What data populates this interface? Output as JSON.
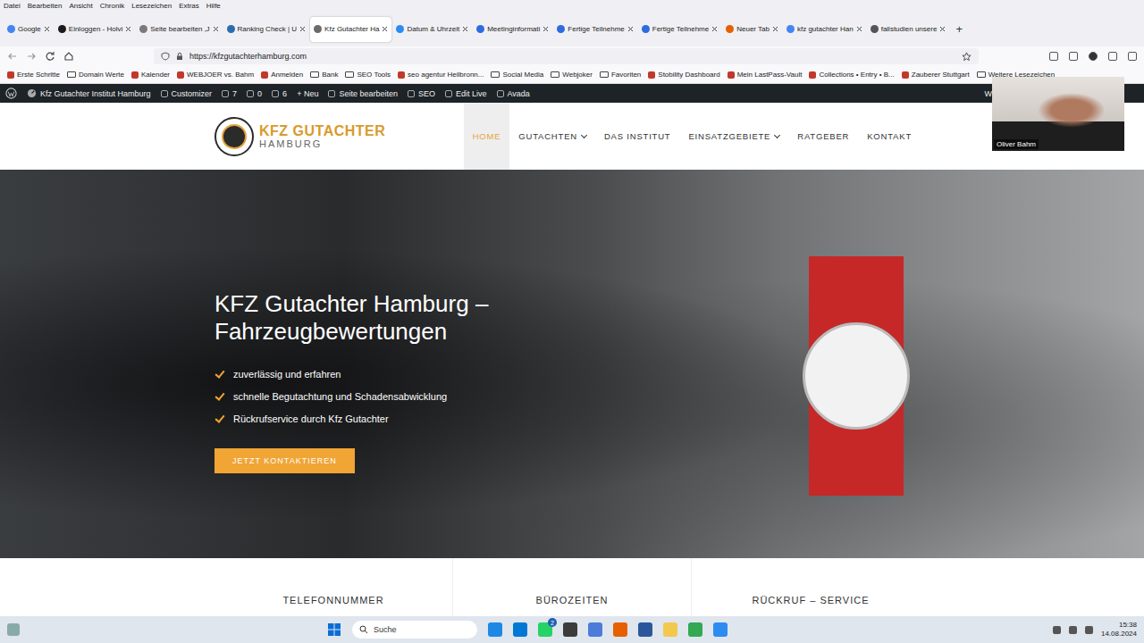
{
  "browser": {
    "menu": [
      "Datei",
      "Bearbeiten",
      "Ansicht",
      "Chronik",
      "Lesezeichen",
      "Extras",
      "Hilfe"
    ],
    "tabs": [
      {
        "label": "Google",
        "selected": false,
        "color": "#4285f4"
      },
      {
        "label": "Einloggen - Holvi",
        "selected": false,
        "color": "#1a1a1a"
      },
      {
        "label": "Seite bearbeiten ‚J",
        "selected": false,
        "color": "#7a7a7a"
      },
      {
        "label": "Ranking Check | U",
        "selected": false,
        "color": "#2b6cb0"
      },
      {
        "label": "Kfz Gutachter Ha",
        "selected": true,
        "color": "#6b6b6b"
      },
      {
        "label": "Datum & Uhrzeit",
        "selected": false,
        "color": "#2d8cf0"
      },
      {
        "label": "Meetinginformati",
        "selected": false,
        "color": "#2d6cdf"
      },
      {
        "label": "Fertige Teilnehme",
        "selected": false,
        "color": "#2d6cdf"
      },
      {
        "label": "Fertige Teilnehme",
        "selected": false,
        "color": "#2d6cdf"
      },
      {
        "label": "Neuer Tab",
        "selected": false,
        "color": "#e66000"
      },
      {
        "label": "kfz gutachter Han",
        "selected": false,
        "color": "#4285f4"
      },
      {
        "label": "fallstudien unsere",
        "selected": false,
        "color": "#555555"
      }
    ],
    "new_tab": "+",
    "url": "https://kfzgutachterhamburg.com",
    "bookmarks": [
      {
        "label": "Erste Schritte",
        "kind": "link"
      },
      {
        "label": "Domain Werte",
        "kind": "folder"
      },
      {
        "label": "Kalender",
        "kind": "link"
      },
      {
        "label": "WEBJOER vs. Bahm",
        "kind": "link"
      },
      {
        "label": "Anmelden",
        "kind": "link"
      },
      {
        "label": "Bank",
        "kind": "folder"
      },
      {
        "label": "SEO Tools",
        "kind": "folder"
      },
      {
        "label": "seo agentur Heilbronn...",
        "kind": "link"
      },
      {
        "label": "Social Media",
        "kind": "folder"
      },
      {
        "label": "Webjoker",
        "kind": "folder"
      },
      {
        "label": "Favoriten",
        "kind": "folder"
      },
      {
        "label": "Stobility Dashboard",
        "kind": "link"
      },
      {
        "label": "Mein LastPass-Vault",
        "kind": "link"
      },
      {
        "label": "Collections • Entry • B...",
        "kind": "link"
      },
      {
        "label": "Zauberer Stuttgart",
        "kind": "link"
      },
      {
        "label": "Weitere Lesezeichen",
        "kind": "folder"
      }
    ]
  },
  "admin_bar": {
    "site": "Kfz Gutachter Institut Hamburg",
    "items": [
      {
        "label": "Customizer",
        "kind": "icon"
      },
      {
        "label": "7",
        "kind": "icon"
      },
      {
        "label": "0",
        "kind": "icon"
      },
      {
        "label": "6",
        "kind": "icon"
      },
      {
        "label": "+ Neu",
        "kind": "plain"
      },
      {
        "label": "Seite bearbeiten",
        "kind": "icon"
      },
      {
        "label": "SEO",
        "kind": "icon"
      },
      {
        "label": "Edit Live",
        "kind": "icon"
      },
      {
        "label": "Avada",
        "kind": "icon"
      }
    ],
    "cut": "W"
  },
  "site": {
    "logo": {
      "title": "KFZ GUTACHTER",
      "subtitle": "HAMBURG"
    },
    "nav": [
      {
        "label": "HOME",
        "selected": true,
        "dropdown": false
      },
      {
        "label": "GUTACHTEN",
        "selected": false,
        "dropdown": true
      },
      {
        "label": "DAS INSTITUT",
        "selected": false,
        "dropdown": false
      },
      {
        "label": "EINSATZGEBIETE",
        "selected": false,
        "dropdown": true
      },
      {
        "label": "RATGEBER",
        "selected": false,
        "dropdown": false
      },
      {
        "label": "KONTAKT",
        "selected": false,
        "dropdown": false
      }
    ],
    "hero": {
      "title": "KFZ Gutachter Hamburg – Fahrzeugbewertungen",
      "points": [
        "zuverlässig und erfahren",
        "schnelle Begutachtung und Schadensabwicklung",
        "Rückrufservice durch Kfz Gutachter"
      ],
      "button": "JETZT KONTAKTIEREN"
    },
    "info": [
      "TELEFONNUMMER",
      "BÜROZEITEN",
      "RÜCKRUF – SERVICE"
    ]
  },
  "video": {
    "name": "Oliver Bahm"
  },
  "taskbar": {
    "search": "Suche",
    "badge": "2",
    "time": "15:38",
    "date": "14.08.2024"
  }
}
